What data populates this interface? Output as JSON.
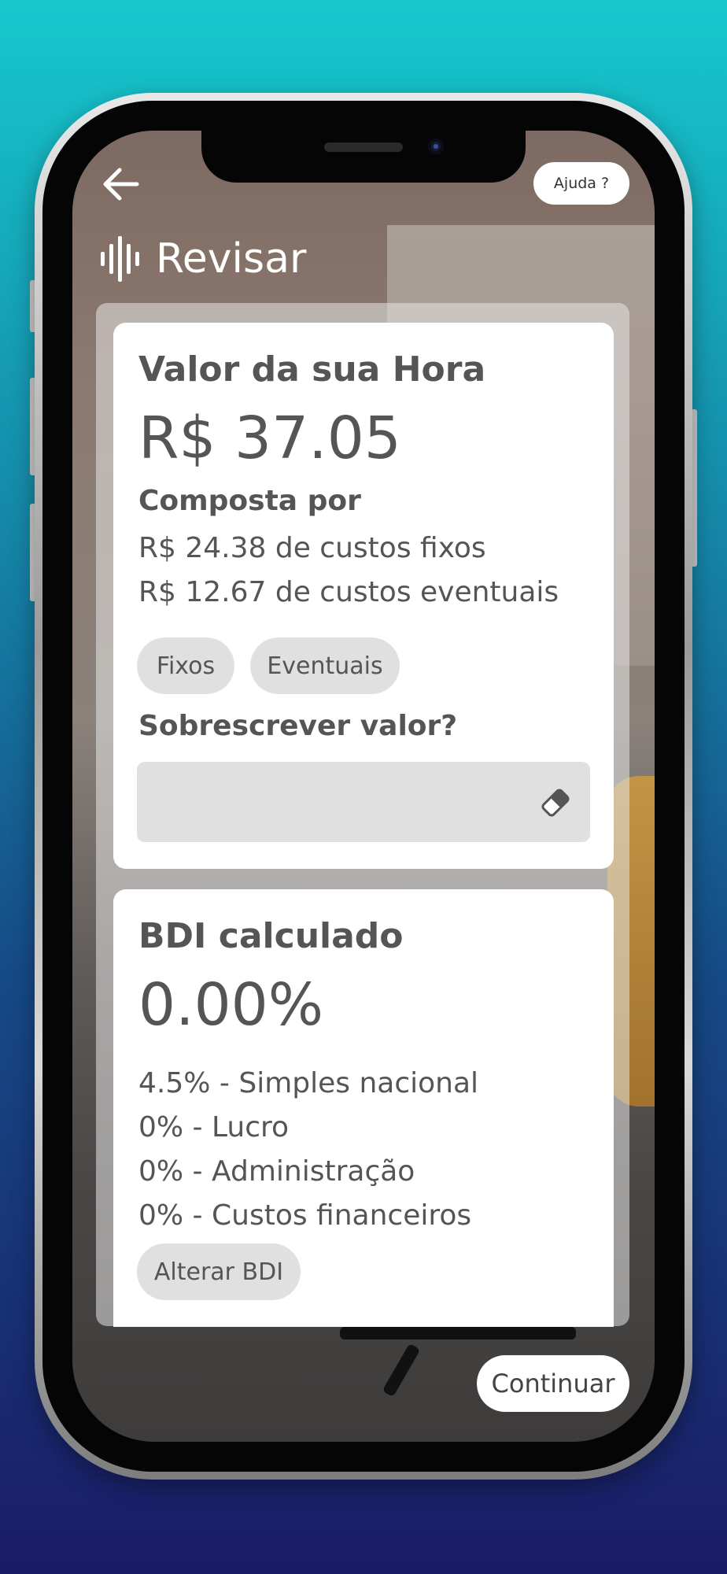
{
  "header": {
    "back_icon": "arrow-left-icon",
    "help_label": "Ajuda ?",
    "title": "Revisar",
    "title_icon": "waveform-icon"
  },
  "hour_card": {
    "heading": "Valor da sua Hora",
    "value": "R$ 37.05",
    "composed_by": "Composta por",
    "fixed_costs": "R$ 24.38 de custos fixos",
    "eventual_costs": "R$ 12.67 de custos eventuais",
    "chip_fixed": "Fixos",
    "chip_eventual": "Eventuais",
    "override_label": "Sobrescrever valor?",
    "override_value": "",
    "override_placeholder": "",
    "clear_icon": "eraser-icon"
  },
  "bdi_card": {
    "heading": "BDI calculado",
    "value": "0.00%",
    "lines": [
      "4.5% - Simples nacional",
      "0% - Lucro",
      "0% - Administração",
      "0% - Custos financeiros"
    ],
    "change_label": "Alterar BDI"
  },
  "footer": {
    "continue_label": "Continuar"
  }
}
